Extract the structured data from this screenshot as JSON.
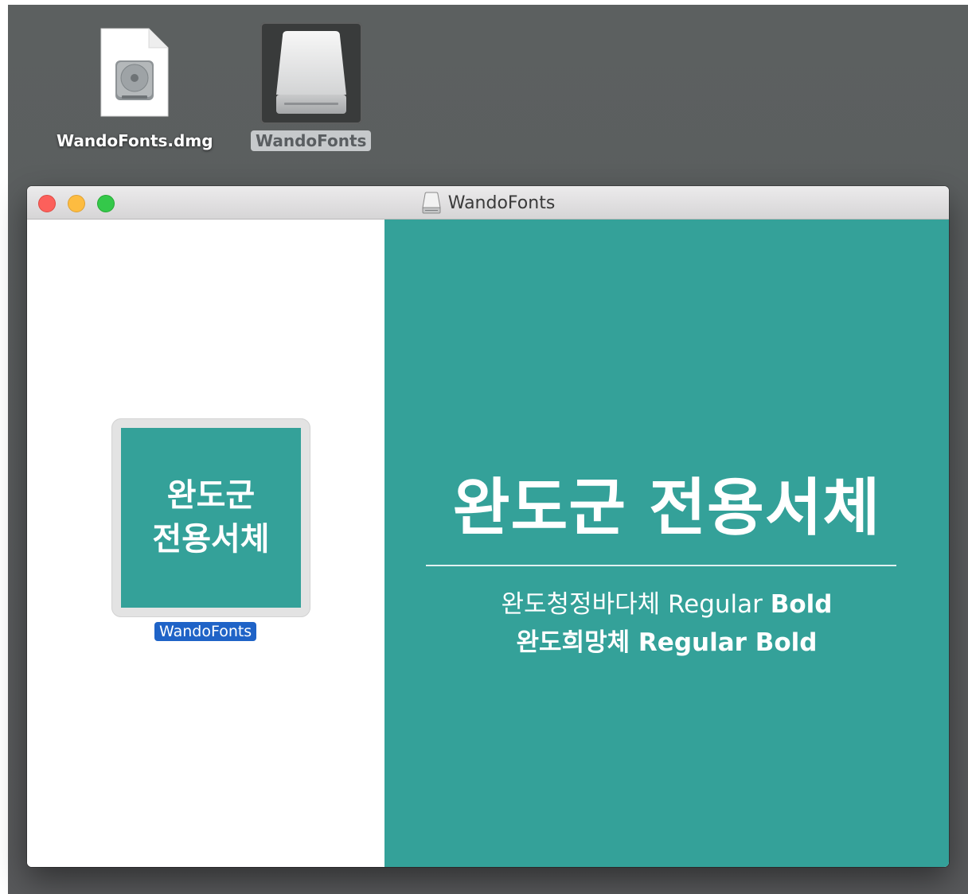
{
  "desktop": {
    "icons": [
      {
        "label": "WandoFonts.dmg",
        "icon": "disk-image-file-icon"
      },
      {
        "label": "WandoFonts",
        "icon": "external-drive-icon",
        "selected": true
      }
    ]
  },
  "window": {
    "title": "WandoFonts",
    "title_icon": "drive-icon",
    "controls": {
      "close": "close",
      "minimize": "minimize",
      "zoom": "zoom"
    },
    "app_icon": {
      "line1": "완도군",
      "line2": "전용서체",
      "label": "WandoFonts"
    },
    "background": {
      "title": "완도군 전용서체",
      "font1_name": "완도청정바다체 Regular",
      "font1_bold": "Bold",
      "font2": "완도희망체 Regular Bold"
    }
  },
  "colors": {
    "teal": "#34a199",
    "selection_blue": "#1f63c7",
    "desktop_gray": "#5a5d5e"
  }
}
